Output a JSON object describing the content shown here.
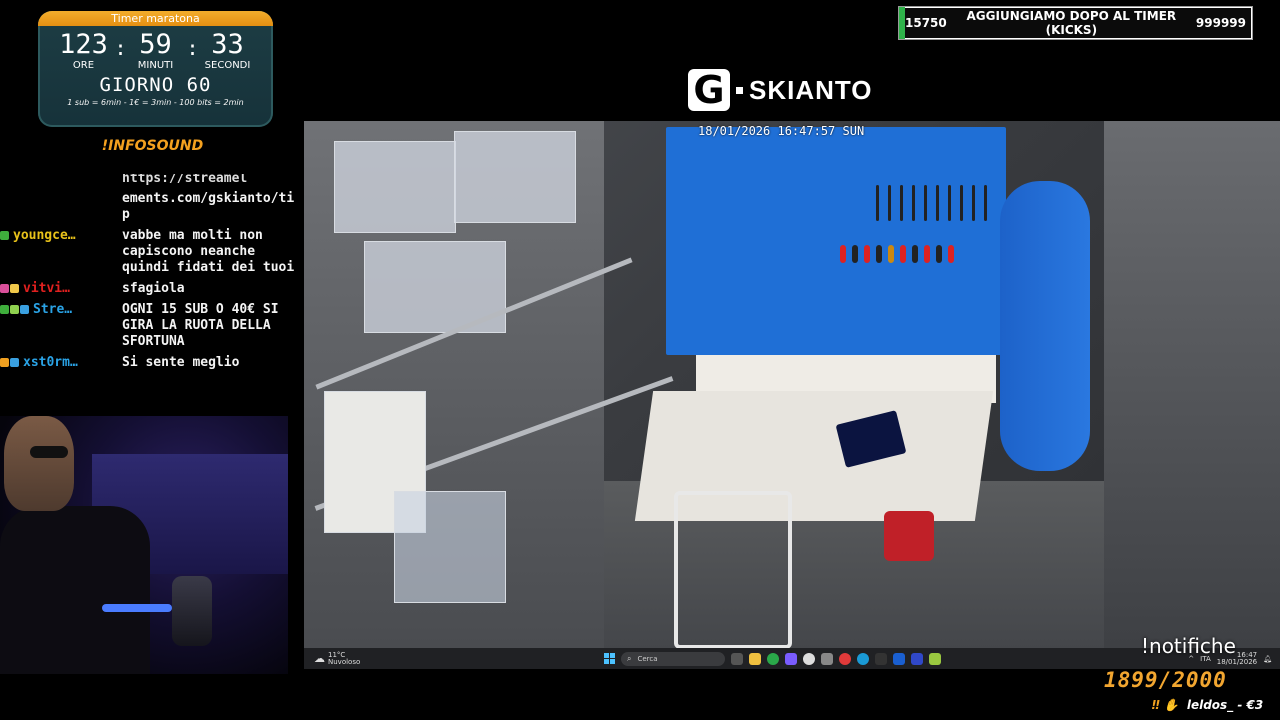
{
  "timer": {
    "title": "Timer maratona",
    "hours": "123",
    "minutes": "59",
    "seconds": "33",
    "sep": ":",
    "hours_label": "ORE",
    "minutes_label": "MINUTI",
    "seconds_label": "SECONDI",
    "day": "GIORNO 60",
    "rules": "1 sub = 6min - 1€ = 3min - 100 bits = 2min"
  },
  "infosound": "!INFOSOUND",
  "chat": {
    "truncated_top": "https://streamel",
    "messages": [
      {
        "user": "",
        "text": "ements.com/gskianto/tip",
        "user_color": "#fff",
        "badges": []
      },
      {
        "user": "youngce…",
        "text": "vabbe ma molti non capiscono neanche quindi fidati dei tuoi",
        "user_color": "#e8c21a",
        "badges": [
          "#3fae3c"
        ]
      },
      {
        "user": "vitvi…",
        "text": "sfagiola",
        "user_color": "#e0201f",
        "badges": [
          "#d94f9a",
          "#f0c84a"
        ]
      },
      {
        "user": "Stre…",
        "text": "OGNI 15 SUB O 40€ SI GIRA LA RUOTA DELLA SFORTUNA",
        "user_color": "#2aa3e6",
        "badges": [
          "#3fae3c",
          "#8fd14f",
          "#3aa0e0"
        ]
      },
      {
        "user": "xst0rm…",
        "text": "Si sente meglio",
        "user_color": "#2aa3e6",
        "badges": [
          "#f0a020",
          "#3aa0e0"
        ]
      }
    ]
  },
  "logo": {
    "letter": "G",
    "text": "SKIANTO"
  },
  "goal": {
    "current": "15750",
    "label": "AGGIUNGIAMO DOPO AL TIMER (KICKS)",
    "target": "999999",
    "progress": 0.0158
  },
  "feed": {
    "timestamp": "18/01/2026 16:47:57 SUN"
  },
  "taskbar": {
    "temp": "11°C",
    "weather": "Nuvoloso",
    "search_placeholder": "Cerca",
    "lang": "ITA",
    "time": "16:47",
    "date": "18/01/2026"
  },
  "overlay": {
    "notifiche": "!notifiche",
    "counter": "1899/2000",
    "ticker": "leldos_ - €3"
  },
  "colors": {
    "accent": "#f2a630",
    "pegboard": "#1f6fd6",
    "timer_bg": "#1d3d44"
  }
}
